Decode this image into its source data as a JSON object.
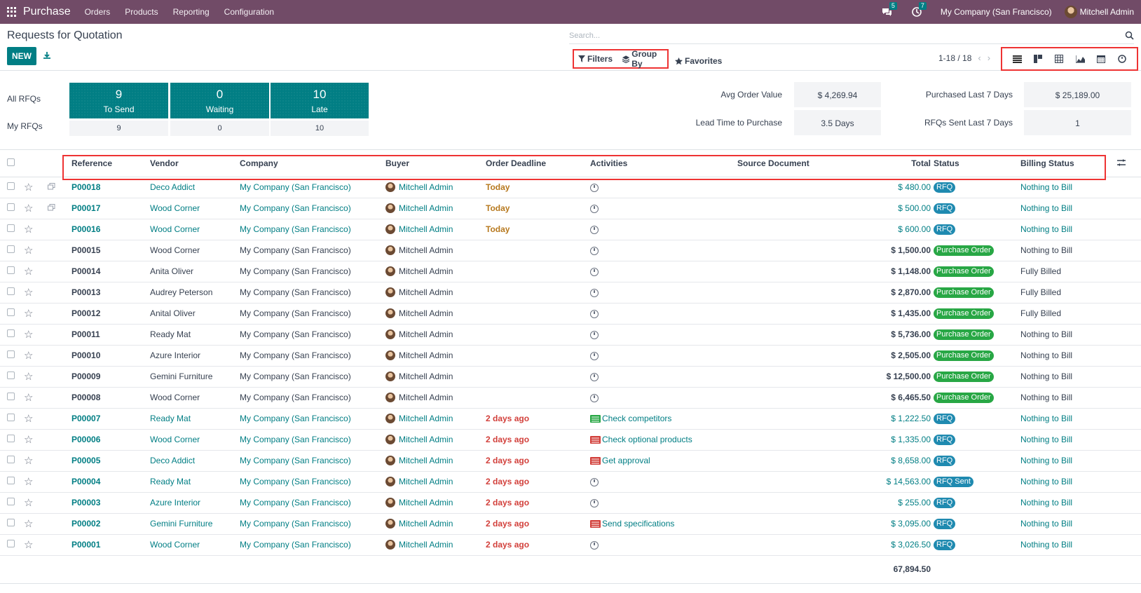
{
  "topbar": {
    "app_name": "Purchase",
    "menu": [
      "Orders",
      "Products",
      "Reporting",
      "Configuration"
    ],
    "messages_count": "5",
    "activities_count": "7",
    "company": "My Company (San Francisco)",
    "user": "Mitchell Admin"
  },
  "control_panel": {
    "title": "Requests for Quotation",
    "new_label": "NEW",
    "search_placeholder": "Search...",
    "filters_label": "Filters",
    "groupby_label": "Group By",
    "favorites_label": "Favorites",
    "pager": "1-18 / 18"
  },
  "dashboard": {
    "all_rfqs_label": "All RFQs",
    "my_rfqs_label": "My RFQs",
    "tiles": [
      {
        "num": "9",
        "label": "To Send",
        "mine": "9"
      },
      {
        "num": "0",
        "label": "Waiting",
        "mine": "0"
      },
      {
        "num": "10",
        "label": "Late",
        "mine": "10"
      }
    ],
    "stats": [
      {
        "label": "Avg Order Value",
        "value": "$ 4,269.94"
      },
      {
        "label": "Purchased Last 7 Days",
        "value": "$ 25,189.00"
      },
      {
        "label": "Lead Time to Purchase",
        "value": "3.5 Days"
      },
      {
        "label": "RFQs Sent Last 7 Days",
        "value": "1"
      }
    ]
  },
  "table": {
    "headers": {
      "reference": "Reference",
      "vendor": "Vendor",
      "company": "Company",
      "buyer": "Buyer",
      "deadline": "Order Deadline",
      "activities": "Activities",
      "source": "Source Document",
      "total": "Total",
      "status": "Status",
      "billing": "Billing Status"
    },
    "rows": [
      {
        "ref": "P00018",
        "vendor": "Deco Addict",
        "company": "My Company (San Francisco)",
        "buyer": "Mitchell Admin",
        "deadline": "Today",
        "activity": "",
        "total": "$ 480.00",
        "status": "RFQ",
        "billing": "Nothing to Bill"
      },
      {
        "ref": "P00017",
        "vendor": "Wood Corner",
        "company": "My Company (San Francisco)",
        "buyer": "Mitchell Admin",
        "deadline": "Today",
        "activity": "",
        "total": "$ 500.00",
        "status": "RFQ",
        "billing": "Nothing to Bill"
      },
      {
        "ref": "P00016",
        "vendor": "Wood Corner",
        "company": "My Company (San Francisco)",
        "buyer": "Mitchell Admin",
        "deadline": "Today",
        "activity": "",
        "total": "$ 600.00",
        "status": "RFQ",
        "billing": "Nothing to Bill"
      },
      {
        "ref": "P00015",
        "vendor": "Wood Corner",
        "company": "My Company (San Francisco)",
        "buyer": "Mitchell Admin",
        "deadline": "",
        "activity": "",
        "total": "$ 1,500.00",
        "status": "Purchase Order",
        "billing": "Nothing to Bill"
      },
      {
        "ref": "P00014",
        "vendor": "Anita Oliver",
        "company": "My Company (San Francisco)",
        "buyer": "Mitchell Admin",
        "deadline": "",
        "activity": "",
        "total": "$ 1,148.00",
        "status": "Purchase Order",
        "billing": "Fully Billed"
      },
      {
        "ref": "P00013",
        "vendor": "Audrey Peterson",
        "company": "My Company (San Francisco)",
        "buyer": "Mitchell Admin",
        "deadline": "",
        "activity": "",
        "total": "$ 2,870.00",
        "status": "Purchase Order",
        "billing": "Fully Billed"
      },
      {
        "ref": "P00012",
        "vendor": "Anital Oliver",
        "company": "My Company (San Francisco)",
        "buyer": "Mitchell Admin",
        "deadline": "",
        "activity": "",
        "total": "$ 1,435.00",
        "status": "Purchase Order",
        "billing": "Fully Billed"
      },
      {
        "ref": "P00011",
        "vendor": "Ready Mat",
        "company": "My Company (San Francisco)",
        "buyer": "Mitchell Admin",
        "deadline": "",
        "activity": "",
        "total": "$ 5,736.00",
        "status": "Purchase Order",
        "billing": "Nothing to Bill"
      },
      {
        "ref": "P00010",
        "vendor": "Azure Interior",
        "company": "My Company (San Francisco)",
        "buyer": "Mitchell Admin",
        "deadline": "",
        "activity": "",
        "total": "$ 2,505.00",
        "status": "Purchase Order",
        "billing": "Nothing to Bill"
      },
      {
        "ref": "P00009",
        "vendor": "Gemini Furniture",
        "company": "My Company (San Francisco)",
        "buyer": "Mitchell Admin",
        "deadline": "",
        "activity": "",
        "total": "$ 12,500.00",
        "status": "Purchase Order",
        "billing": "Nothing to Bill"
      },
      {
        "ref": "P00008",
        "vendor": "Wood Corner",
        "company": "My Company (San Francisco)",
        "buyer": "Mitchell Admin",
        "deadline": "",
        "activity": "",
        "total": "$ 6,465.50",
        "status": "Purchase Order",
        "billing": "Nothing to Bill"
      },
      {
        "ref": "P00007",
        "vendor": "Ready Mat",
        "company": "My Company (San Francisco)",
        "buyer": "Mitchell Admin",
        "deadline": "2 days ago",
        "activity": "Check competitors",
        "activity_color": "#28a745",
        "total": "$ 1,222.50",
        "status": "RFQ",
        "billing": "Nothing to Bill"
      },
      {
        "ref": "P00006",
        "vendor": "Wood Corner",
        "company": "My Company (San Francisco)",
        "buyer": "Mitchell Admin",
        "deadline": "2 days ago",
        "activity": "Check optional products",
        "activity_color": "#d23f3a",
        "total": "$ 1,335.00",
        "status": "RFQ",
        "billing": "Nothing to Bill"
      },
      {
        "ref": "P00005",
        "vendor": "Deco Addict",
        "company": "My Company (San Francisco)",
        "buyer": "Mitchell Admin",
        "deadline": "2 days ago",
        "activity": "Get approval",
        "activity_color": "#d23f3a",
        "total": "$ 8,658.00",
        "status": "RFQ",
        "billing": "Nothing to Bill"
      },
      {
        "ref": "P00004",
        "vendor": "Ready Mat",
        "company": "My Company (San Francisco)",
        "buyer": "Mitchell Admin",
        "deadline": "2 days ago",
        "activity": "",
        "total": "$ 14,563.00",
        "status": "RFQ Sent",
        "billing": "Nothing to Bill"
      },
      {
        "ref": "P00003",
        "vendor": "Azure Interior",
        "company": "My Company (San Francisco)",
        "buyer": "Mitchell Admin",
        "deadline": "2 days ago",
        "activity": "",
        "total": "$ 255.00",
        "status": "RFQ",
        "billing": "Nothing to Bill"
      },
      {
        "ref": "P00002",
        "vendor": "Gemini Furniture",
        "company": "My Company (San Francisco)",
        "buyer": "Mitchell Admin",
        "deadline": "2 days ago",
        "activity": "Send specifications",
        "activity_color": "#d23f3a",
        "total": "$ 3,095.00",
        "status": "RFQ",
        "billing": "Nothing to Bill"
      },
      {
        "ref": "P00001",
        "vendor": "Wood Corner",
        "company": "My Company (San Francisco)",
        "buyer": "Mitchell Admin",
        "deadline": "2 days ago",
        "activity": "",
        "total": "$ 3,026.50",
        "status": "RFQ",
        "billing": "Nothing to Bill"
      }
    ],
    "grand_total": "67,894.50"
  },
  "colors": {
    "brand": "#714b67",
    "accent": "#017e84",
    "rfq_pill": "#1f8ab0",
    "po_pill": "#28a745",
    "late": "#d23f3a",
    "today": "#b7791f"
  }
}
